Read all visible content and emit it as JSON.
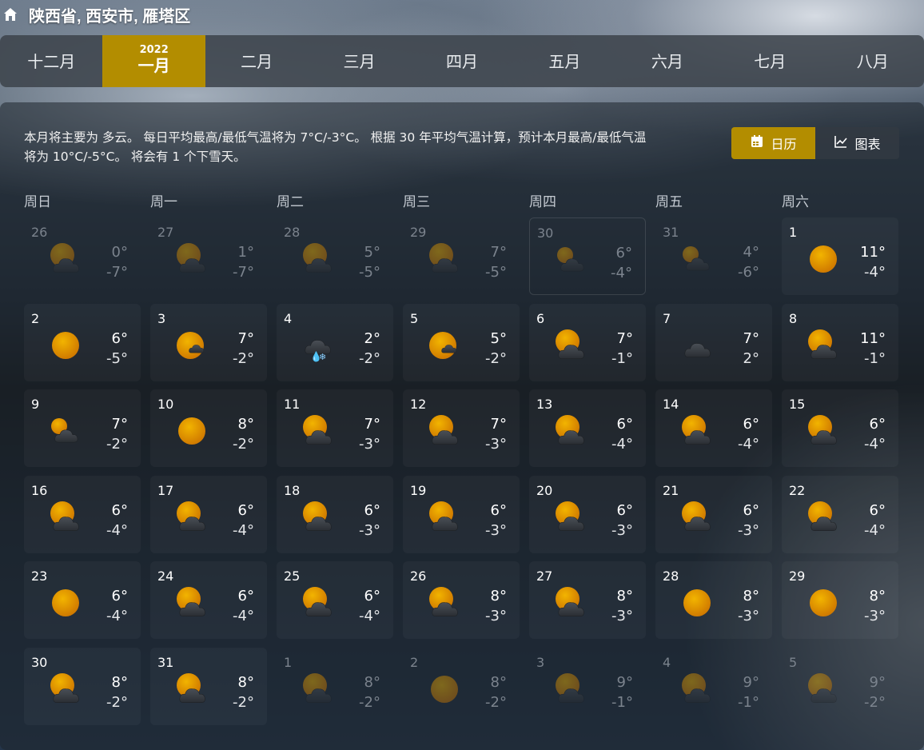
{
  "location": "陕西省, 西安市, 雁塔区",
  "months": [
    {
      "label": "十二月",
      "year": "",
      "active": false
    },
    {
      "label": "一月",
      "year": "2022",
      "active": true
    },
    {
      "label": "二月",
      "year": "",
      "active": false
    },
    {
      "label": "三月",
      "year": "",
      "active": false
    },
    {
      "label": "四月",
      "year": "",
      "active": false
    },
    {
      "label": "五月",
      "year": "",
      "active": false
    },
    {
      "label": "六月",
      "year": "",
      "active": false
    },
    {
      "label": "七月",
      "year": "",
      "active": false
    },
    {
      "label": "八月",
      "year": "",
      "active": false
    }
  ],
  "summary": "本月将主要为 多云。 每日平均最高/最低气温将为 7°C/-3°C。 根据 30 年平均气温计算，预计本月最高/最低气温将为 10°C/-5°C。 将会有 1 个下雪天。",
  "view_toggle": {
    "calendar_label": "日历",
    "chart_label": "图表",
    "calendar_icon": "calendar-icon",
    "chart_icon": "line-chart-icon"
  },
  "accent_color": "#b38d00",
  "weekdays": [
    "周日",
    "周一",
    "周二",
    "周三",
    "周四",
    "周五",
    "周六"
  ],
  "days": [
    {
      "day": "26",
      "hi": "0°",
      "lo": "-7°",
      "icon": "partly-cloudy",
      "dim": true
    },
    {
      "day": "27",
      "hi": "1°",
      "lo": "-7°",
      "icon": "partly-cloudy",
      "dim": true
    },
    {
      "day": "28",
      "hi": "5°",
      "lo": "-5°",
      "icon": "partly-cloudy",
      "dim": true
    },
    {
      "day": "29",
      "hi": "7°",
      "lo": "-5°",
      "icon": "partly-cloudy",
      "dim": true
    },
    {
      "day": "30",
      "hi": "6°",
      "lo": "-4°",
      "icon": "mostly-cloudy",
      "dim": true,
      "today": true
    },
    {
      "day": "31",
      "hi": "4°",
      "lo": "-6°",
      "icon": "mostly-cloudy",
      "dim": true
    },
    {
      "day": "1",
      "hi": "11°",
      "lo": "-4°",
      "icon": "sunny",
      "dim": false
    },
    {
      "day": "2",
      "hi": "6°",
      "lo": "-5°",
      "icon": "sunny",
      "dim": false
    },
    {
      "day": "3",
      "hi": "7°",
      "lo": "-2°",
      "icon": "mostly-sunny",
      "dim": false
    },
    {
      "day": "4",
      "hi": "2°",
      "lo": "-2°",
      "icon": "rain-snow",
      "dim": false
    },
    {
      "day": "5",
      "hi": "5°",
      "lo": "-2°",
      "icon": "mostly-sunny",
      "dim": false
    },
    {
      "day": "6",
      "hi": "7°",
      "lo": "-1°",
      "icon": "partly-cloudy",
      "dim": false
    },
    {
      "day": "7",
      "hi": "7°",
      "lo": "2°",
      "icon": "cloudy",
      "dim": false
    },
    {
      "day": "8",
      "hi": "11°",
      "lo": "-1°",
      "icon": "partly-cloudy",
      "dim": false
    },
    {
      "day": "9",
      "hi": "7°",
      "lo": "-2°",
      "icon": "mostly-cloudy",
      "dim": false
    },
    {
      "day": "10",
      "hi": "8°",
      "lo": "-2°",
      "icon": "sunny",
      "dim": false
    },
    {
      "day": "11",
      "hi": "7°",
      "lo": "-3°",
      "icon": "partly-cloudy",
      "dim": false
    },
    {
      "day": "12",
      "hi": "7°",
      "lo": "-3°",
      "icon": "partly-cloudy",
      "dim": false
    },
    {
      "day": "13",
      "hi": "6°",
      "lo": "-4°",
      "icon": "partly-cloudy",
      "dim": false
    },
    {
      "day": "14",
      "hi": "6°",
      "lo": "-4°",
      "icon": "partly-cloudy",
      "dim": false
    },
    {
      "day": "15",
      "hi": "6°",
      "lo": "-4°",
      "icon": "partly-cloudy",
      "dim": false
    },
    {
      "day": "16",
      "hi": "6°",
      "lo": "-4°",
      "icon": "partly-cloudy",
      "dim": false
    },
    {
      "day": "17",
      "hi": "6°",
      "lo": "-4°",
      "icon": "partly-cloudy",
      "dim": false
    },
    {
      "day": "18",
      "hi": "6°",
      "lo": "-3°",
      "icon": "partly-cloudy",
      "dim": false
    },
    {
      "day": "19",
      "hi": "6°",
      "lo": "-3°",
      "icon": "partly-cloudy",
      "dim": false
    },
    {
      "day": "20",
      "hi": "6°",
      "lo": "-3°",
      "icon": "partly-cloudy",
      "dim": false
    },
    {
      "day": "21",
      "hi": "6°",
      "lo": "-3°",
      "icon": "partly-cloudy",
      "dim": false
    },
    {
      "day": "22",
      "hi": "6°",
      "lo": "-4°",
      "icon": "partly-cloudy",
      "dim": false
    },
    {
      "day": "23",
      "hi": "6°",
      "lo": "-4°",
      "icon": "sunny",
      "dim": false
    },
    {
      "day": "24",
      "hi": "6°",
      "lo": "-4°",
      "icon": "partly-cloudy",
      "dim": false
    },
    {
      "day": "25",
      "hi": "6°",
      "lo": "-4°",
      "icon": "partly-cloudy",
      "dim": false
    },
    {
      "day": "26",
      "hi": "8°",
      "lo": "-3°",
      "icon": "partly-cloudy",
      "dim": false
    },
    {
      "day": "27",
      "hi": "8°",
      "lo": "-3°",
      "icon": "partly-cloudy",
      "dim": false
    },
    {
      "day": "28",
      "hi": "8°",
      "lo": "-3°",
      "icon": "sunny",
      "dim": false
    },
    {
      "day": "29",
      "hi": "8°",
      "lo": "-3°",
      "icon": "sunny",
      "dim": false
    },
    {
      "day": "30",
      "hi": "8°",
      "lo": "-2°",
      "icon": "partly-cloudy",
      "dim": false
    },
    {
      "day": "31",
      "hi": "8°",
      "lo": "-2°",
      "icon": "partly-cloudy",
      "dim": false
    },
    {
      "day": "1",
      "hi": "8°",
      "lo": "-2°",
      "icon": "partly-cloudy",
      "dim": true
    },
    {
      "day": "2",
      "hi": "8°",
      "lo": "-2°",
      "icon": "sunny",
      "dim": true
    },
    {
      "day": "3",
      "hi": "9°",
      "lo": "-1°",
      "icon": "partly-cloudy",
      "dim": true
    },
    {
      "day": "4",
      "hi": "9°",
      "lo": "-1°",
      "icon": "partly-cloudy",
      "dim": true
    },
    {
      "day": "5",
      "hi": "9°",
      "lo": "-2°",
      "icon": "partly-cloudy",
      "dim": true
    }
  ]
}
